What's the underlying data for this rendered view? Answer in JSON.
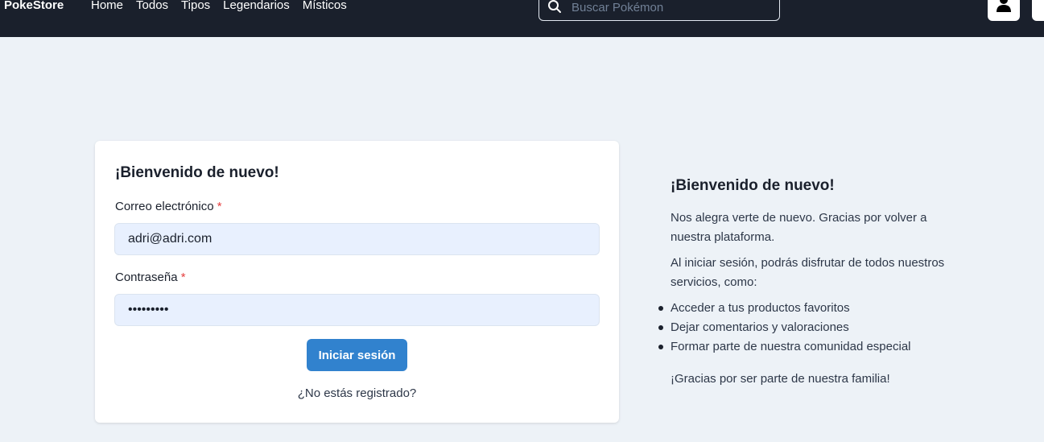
{
  "navbar": {
    "brand": "PokeStore",
    "links": [
      "Home",
      "Todos",
      "Tipos",
      "Legendarios",
      "Místicos"
    ],
    "search_placeholder": "Buscar Pokémon",
    "user_icon": "user-icon"
  },
  "login": {
    "title": "¡Bienvenido de nuevo!",
    "email_label": "Correo electrónico",
    "email_value": "adri@adri.com",
    "password_label": "Contraseña",
    "password_value": "•••••••••",
    "required_mark": "*",
    "submit_label": "Iniciar sesión",
    "register_link": "¿No estás registrado?"
  },
  "side": {
    "title": "¡Bienvenido de nuevo!",
    "p1": "Nos alegra verte de nuevo. Gracias por volver a nuestra plataforma.",
    "p2": "Al iniciar sesión, podrás disfrutar de todos nuestros servicios, como:",
    "items": [
      "Acceder a tus productos favoritos",
      "Dejar comentarios y valoraciones",
      "Formar parte de nuestra comunidad especial"
    ],
    "closing": "¡Gracias por ser parte de nuestra familia!"
  },
  "colors": {
    "navbar_bg": "#1a202c",
    "page_bg": "#edf2f7",
    "primary_button": "#3182ce",
    "required": "#e53e3e",
    "input_bg": "#e8f0fe"
  }
}
